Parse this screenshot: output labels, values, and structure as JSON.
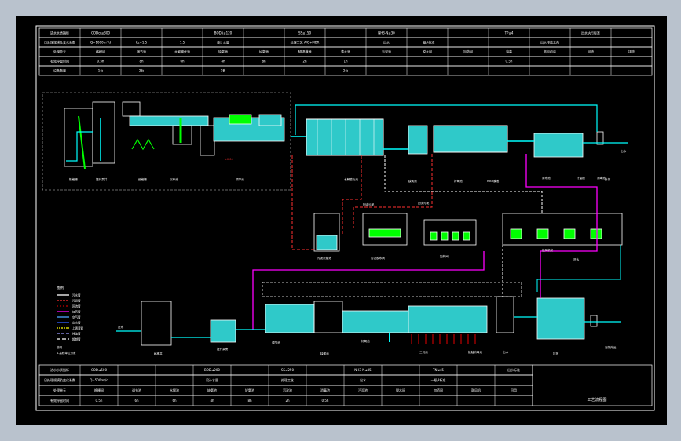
{
  "colors": {
    "background": "#b9c2cd",
    "sheet": "#000000",
    "frame": "#ffffff",
    "pipe_blue": "#00ffff",
    "pipe_red": "#ff3030",
    "pipe_magenta": "#ff00ff",
    "equipment_green": "#00ff00",
    "fill_cyan": "#2fc9c9",
    "dark_red": "#c00000",
    "pipe_yellow": "#ffff00"
  },
  "top_table": {
    "rows": [
      [
        "进水水质指标",
        "CODcr≤300",
        "",
        "",
        "BOD5≤120",
        "",
        "SS≤150",
        "",
        "NH3-N≤30",
        "",
        "",
        "TP≤4",
        "",
        "出水执行标准",
        ""
      ],
      [
        "日处理规模及变化系数",
        "Q=1000m³/d",
        "Kz=1.5",
        "1.5",
        "设计水量",
        "",
        "处理工艺 A/O+MBR",
        "",
        "出水",
        "一级A标准",
        "",
        "",
        "出水排放去向",
        "",
        ""
      ],
      [
        "处理单元",
        "格栅间",
        "调节池",
        "水解酸化池",
        "缺氧池",
        "好氧池",
        "MBR膜池",
        "清水池",
        "污泥池",
        "脱水间",
        "加药间",
        "消毒",
        "鼓风机房",
        "回流",
        "排放"
      ],
      [
        "有效停留时间",
        "0.5h",
        "8h",
        "6h",
        "4h",
        "8h",
        "2h",
        "1h",
        "",
        "",
        "",
        "0.5h",
        "",
        "",
        ""
      ],
      [
        "设备数量",
        "1台",
        "2台",
        "",
        "1套",
        "",
        "",
        "2台",
        "",
        "",
        "",
        "",
        "",
        "",
        ""
      ]
    ]
  },
  "bottom_table": {
    "rows": [
      [
        "进水水质指标",
        "COD≤500",
        "",
        "",
        "BOD≤200",
        "",
        "SS≤250",
        "",
        "NH3-N≤35",
        "",
        "TN≤45",
        "",
        "出水标准"
      ],
      [
        "日处理规模及变化系数",
        "Q=500m³/d",
        "",
        "",
        "设计水量",
        "",
        "处理工艺",
        "",
        "出水",
        "",
        "一级B标准",
        "",
        ""
      ],
      [
        "处理单元",
        "格栅间",
        "调节池",
        "水解池",
        "缺氧池",
        "好氧池",
        "沉淀池",
        "消毒池",
        "污泥池",
        "脱水间",
        "加药间",
        "鼓风机",
        "回用"
      ],
      [
        "有效停留时间",
        "0.5h",
        "6h",
        "6h",
        "4h",
        "8h",
        "2h",
        "0.5h",
        "",
        "",
        "",
        "",
        ""
      ]
    ],
    "drawing_title": "工艺流程图"
  },
  "legend": {
    "title": "图例",
    "items": [
      "污水管",
      "污泥管",
      "回流管",
      "加药管",
      "空气管",
      "出水管",
      "上清液管",
      "排渣管",
      "超越管"
    ],
    "notes": [
      "说明",
      "1.高程单位为米"
    ]
  },
  "process_labels": {
    "upper": [
      "粗格栅",
      "提升泵井",
      "细格栅",
      "沉砂池",
      "调节池",
      "水解酸化池",
      "缺氧池",
      "好氧池",
      "MBR膜池",
      "清水池",
      "消毒池",
      "出水",
      "外排",
      "计量槽"
    ],
    "middle": [
      "污泥浓缩池",
      "污泥脱水间",
      "加药间",
      "鼓风机房",
      "回流污泥",
      "剩余污泥",
      "进水"
    ],
    "lower": [
      "进水",
      "格栅井",
      "提升泵房",
      "调节池",
      "缺氧池",
      "好氧池",
      "二沉池",
      "接触消毒池",
      "出水",
      "排放",
      "泥饼外运"
    ]
  },
  "elevation_tag": "±0.00"
}
